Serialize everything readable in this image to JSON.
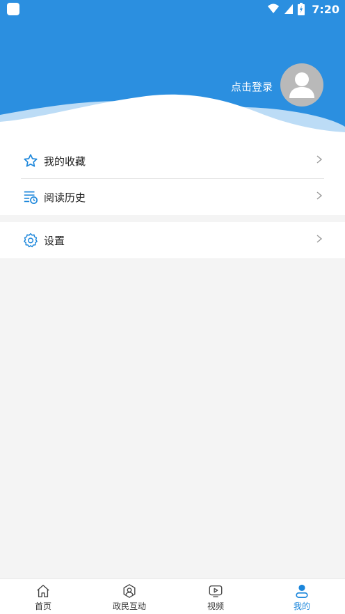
{
  "status_bar": {
    "time": "7:20"
  },
  "header": {
    "login_text": "点击登录"
  },
  "menu": {
    "items": [
      {
        "label": "我的收藏"
      },
      {
        "label": "阅读历史"
      },
      {
        "label": "设置"
      }
    ]
  },
  "bottom_nav": {
    "items": [
      {
        "label": "首页"
      },
      {
        "label": "政民互动"
      },
      {
        "label": "视频"
      },
      {
        "label": "我的"
      }
    ],
    "active_index": 3
  },
  "colors": {
    "header_blue": "#2b8fe0",
    "accent": "#1b86db",
    "background": "#f4f4f4"
  }
}
